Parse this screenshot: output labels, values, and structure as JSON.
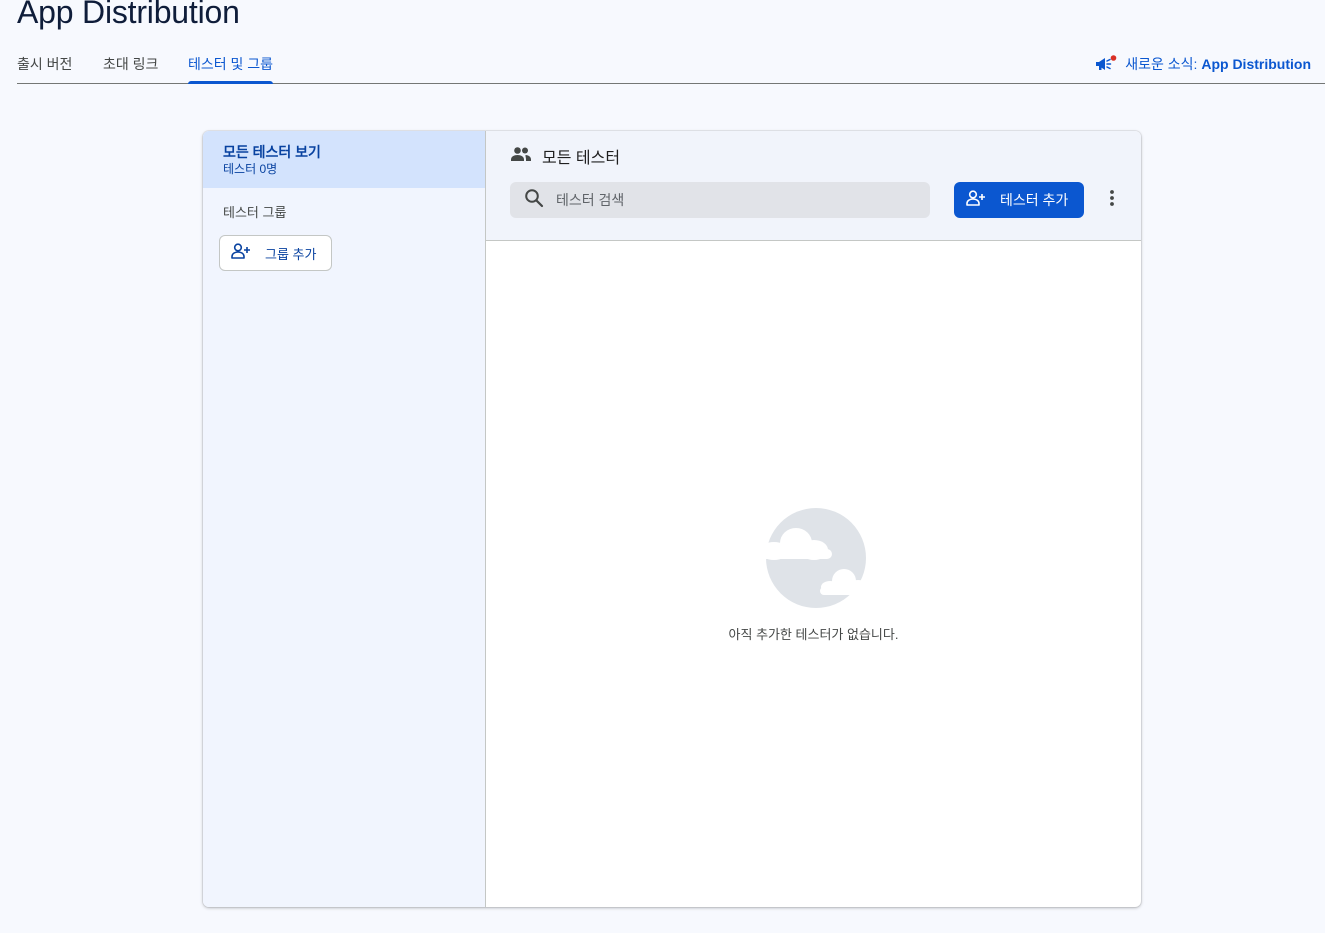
{
  "page": {
    "title": "App Distribution"
  },
  "tabs": [
    {
      "label": "출시 버전",
      "active": false
    },
    {
      "label": "초대 링크",
      "active": false
    },
    {
      "label": "테스터 및 그룹",
      "active": true
    }
  ],
  "whats_new": {
    "prefix": "새로운 소식: ",
    "product": "App Distribution",
    "icon": "megaphone-icon",
    "badge_color": "#d93025"
  },
  "sidebar": {
    "all_testers": {
      "title": "모든 테스터 보기",
      "count": "테스터 0명"
    },
    "groups_label": "테스터 그룹",
    "add_group_label": "그룹 추가"
  },
  "main": {
    "title": "모든 테스터",
    "search_placeholder": "테스터 검색",
    "add_tester_label": "테스터 추가",
    "empty_message": "아직 추가한 테스터가 없습니다."
  },
  "colors": {
    "accent": "#0b57d0",
    "selected_bg": "#d3e3fd"
  }
}
